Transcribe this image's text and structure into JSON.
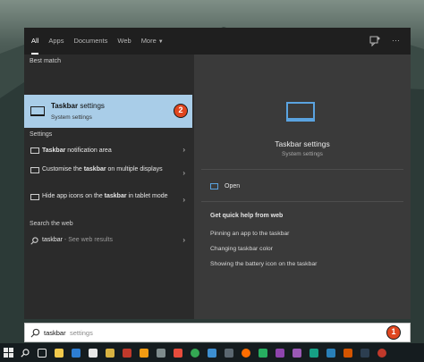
{
  "filters": [
    "All",
    "Apps",
    "Documents",
    "Web",
    "More"
  ],
  "best_match": {
    "section": "Best match",
    "title_bold": "Taskbar",
    "title_rest": " settings",
    "subtitle": "System settings",
    "badge": "2"
  },
  "settings": {
    "section": "Settings",
    "items": [
      {
        "bold": "Taskbar",
        "rest": " notification area"
      },
      {
        "pre": "Customise the ",
        "bold": "taskbar",
        "rest": " on multiple displays"
      },
      {
        "pre": "Hide app icons on the ",
        "bold": "taskbar",
        "rest": " in tablet mode"
      }
    ]
  },
  "search_web": {
    "section": "Search the web",
    "query": "taskbar",
    "hint": " - See web results"
  },
  "details": {
    "title": "Taskbar settings",
    "subtitle": "System settings",
    "open_label": "Open",
    "help_title": "Get quick help from web",
    "help_links": [
      "Pinning an app to the taskbar",
      "Changing taskbar color",
      "Showing the battery icon on the taskbar"
    ]
  },
  "search_bar": {
    "typed": "taskbar",
    "suggestion": "settings",
    "badge": "1"
  },
  "colors": {
    "selection": "#a9cde8",
    "accent": "#5aa3e0",
    "badge": "#e0461f"
  },
  "icons": [
    "search-icon",
    "feedback-icon",
    "more-icon",
    "monitor-icon",
    "chevron-right-icon",
    "open-icon",
    "windows-icon",
    "task-view-icon"
  ]
}
